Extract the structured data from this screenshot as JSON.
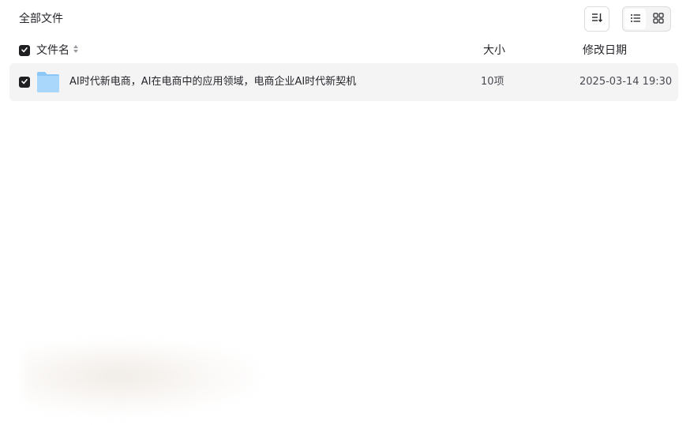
{
  "breadcrumb": {
    "title": "全部文件"
  },
  "toolbar": {
    "sort_icon": "sort-icon",
    "view_list_icon": "list-view-icon",
    "view_grid_icon": "grid-view-icon",
    "active_view": "list"
  },
  "table": {
    "columns": {
      "name": "文件名",
      "size": "大小",
      "date": "修改日期"
    },
    "rows": [
      {
        "checked": true,
        "type": "folder",
        "icon": "folder-icon",
        "name": "AI时代新电商，AI在电商中的应用领域，电商企业AI时代新契机",
        "size": "10项",
        "date": "2025-03-14 19:30"
      }
    ]
  },
  "colors": {
    "checkbox": "#1f1f22",
    "row_bg": "#f4f4f5",
    "folder": "#7bbcf5"
  }
}
